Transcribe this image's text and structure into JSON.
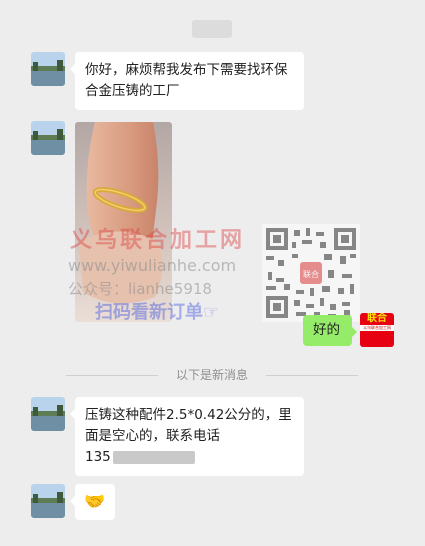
{
  "messages": [
    {
      "text": "你好，麻烦帮我发布下需要找环保合金压铸的工厂"
    },
    {
      "reply_text": "好的"
    },
    {
      "text": "压铸这种配件2.5*0.42公分的，里面是空心的，联系电话",
      "phone_visible": "135"
    },
    {
      "emoji": "🤝"
    }
  ],
  "divider": {
    "label": "以下是新消息"
  },
  "watermark": {
    "title": "义乌联合加工网",
    "url": "www.yiwulianhe.com",
    "gzh": "公众号：lianhe5918",
    "scan": "扫码看新订单☞",
    "qr_center": "联合"
  },
  "self_avatar": {
    "top": "联合",
    "mid": "义乌联合加工网"
  },
  "colors": {
    "background": "#ededed",
    "bubble_in": "#ffffff",
    "bubble_out": "#95ec69",
    "watermark_red": "#de3c3c"
  }
}
